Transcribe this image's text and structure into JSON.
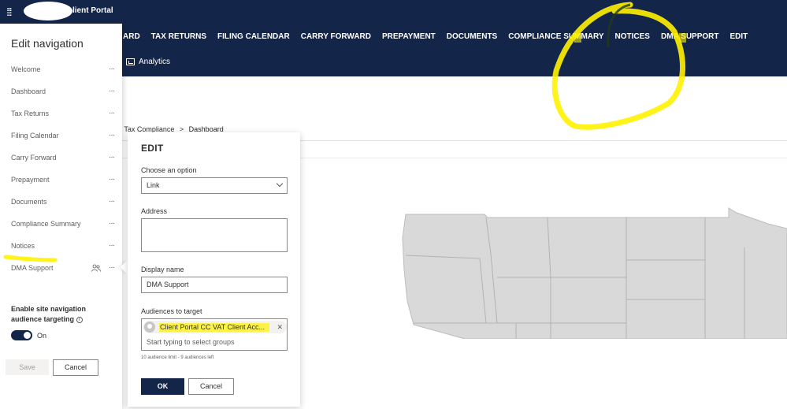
{
  "header": {
    "site_title": "lient Portal",
    "nav_items": [
      "ARD",
      "TAX RETURNS",
      "FILING CALENDAR",
      "CARRY FORWARD",
      "PREPAYMENT",
      "DOCUMENTS",
      "COMPLIANCE SUMMARY",
      "NOTICES",
      "DMA SUPPORT",
      "EDIT"
    ],
    "sub_item": "Analytics"
  },
  "breadcrumb": {
    "parent": "n Tax Compliance",
    "separator": ">",
    "current": "Dashboard"
  },
  "left_panel": {
    "title": "Edit navigation",
    "items": [
      {
        "label": "Welcome"
      },
      {
        "label": "Dashboard"
      },
      {
        "label": "Tax Returns"
      },
      {
        "label": "Filing Calendar"
      },
      {
        "label": "Carry Forward"
      },
      {
        "label": "Prepayment"
      },
      {
        "label": "Documents"
      },
      {
        "label": "Compliance Summary"
      },
      {
        "label": "Notices"
      },
      {
        "label": "DMA Support"
      }
    ],
    "more_glyph": "···",
    "targeting_label": "Enable site navigation audience targeting",
    "info_glyph": "i",
    "toggle_state": "On",
    "save_label": "Save",
    "cancel_label": "Cancel"
  },
  "edit_callout": {
    "title": "EDIT",
    "option_label": "Choose an option",
    "option_value": "Link",
    "address_label": "Address",
    "address_value": "",
    "display_name_label": "Display name",
    "display_name_value": "DMA Support",
    "audiences_label": "Audiences to target",
    "audience_pill": "Client Portal CC VAT Client Acc...",
    "remove_glyph": "✕",
    "people_placeholder": "Start typing to select groups",
    "hint": "10 audience limit - 9 audiences left",
    "ok_label": "OK",
    "cancel_label": "Cancel"
  },
  "colors": {
    "suite_bar": "#14254a",
    "highlighter": "#fff200",
    "map_fill": "#d9d9d9"
  }
}
